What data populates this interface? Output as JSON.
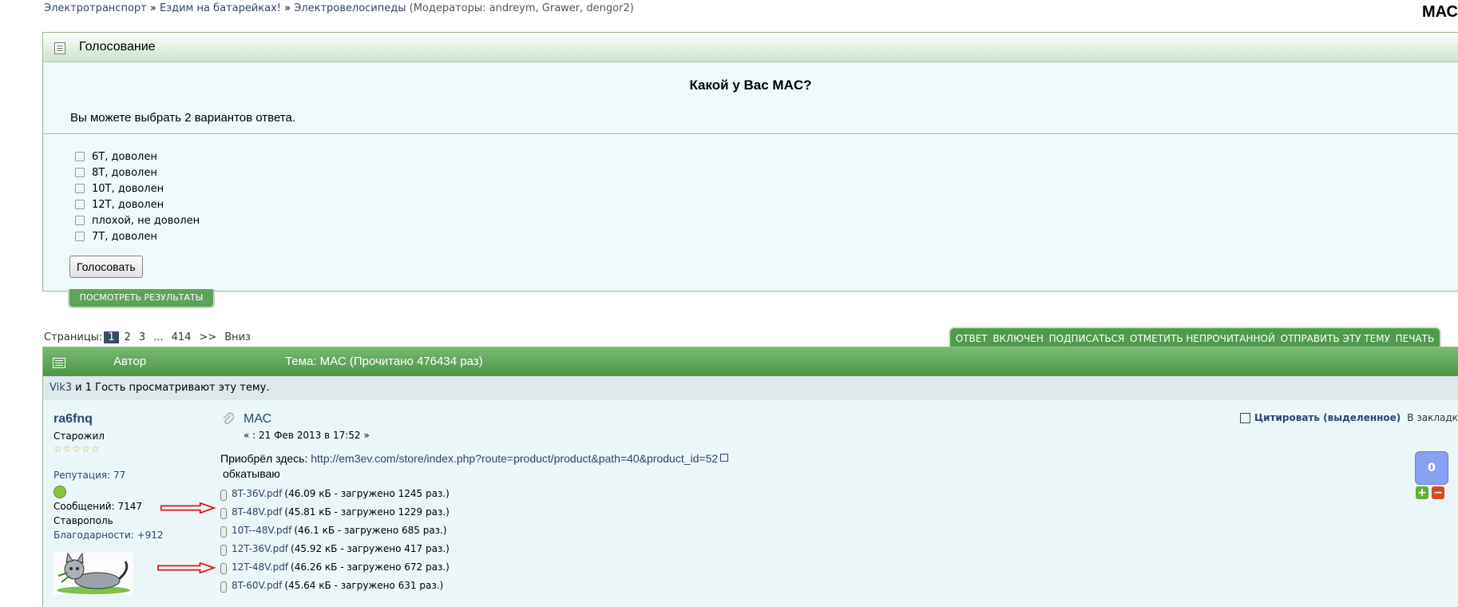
{
  "breadcrumb": {
    "items": [
      "Электротранспорт",
      "Ездим на батарейках!",
      "Электровелосипеды"
    ],
    "sep": " » ",
    "moderators": "(Модераторы: andreym, Grawer, dengor2)"
  },
  "corner_title": "МАС",
  "poll": {
    "header": "Голосование",
    "question": "Какой у Вас MAC?",
    "hint": "Вы можете выбрать 2 вариантов ответа.",
    "options": [
      "6T, доволен",
      "8T, доволен",
      "10T, доволен",
      "12T, доволен",
      "плохой, не доволен",
      "7T, доволен"
    ],
    "vote_label": "Голосовать",
    "results_label": "ПОСМОТРЕТЬ РЕЗУЛЬТАТЫ"
  },
  "pager": {
    "label": "Страницы:",
    "current": "1",
    "pages": [
      "2",
      "3",
      "...",
      "414"
    ],
    "next": ">>",
    "down": "Вниз"
  },
  "actions": [
    "ОТВЕТ",
    "ВКЛЮЧЕН",
    "ПОДПИСАТЬСЯ",
    "ОТМЕТИТЬ НЕПРОЧИТАННОЙ",
    "ОТПРАВИТЬ ЭТУ ТЕМУ",
    "ПЕЧАТЬ"
  ],
  "topic": {
    "author_col": "Автор",
    "title": "Тема: МАС  (Прочитано 476434 раз)"
  },
  "viewers": {
    "user": "Vik3",
    "text": " и 1 Гость просматривают эту тему."
  },
  "poster": {
    "name": "ra6fnq",
    "rank": "Старожил",
    "stars": "☆☆☆☆☆",
    "reputation": "Репутация: 77",
    "posts": "Сообщений: 7147",
    "location": "Ставрополь",
    "thanks": "Благодарности: +912"
  },
  "post": {
    "title": "МАС",
    "date": "« : 21 Фев 2013 в 17:52 »",
    "bought_label": "Приобрёл здесь: ",
    "bought_url": "http://em3ev.com/store/index.php?route=product/product&path=40&product_id=52",
    "body": "обкатываю",
    "attachments": [
      {
        "name": "8T-36V.pdf",
        "meta": "(46.09 кБ - загружено 1245 раз.)"
      },
      {
        "name": "8T-48V.pdf",
        "meta": "(45.81 кБ - загружено 1229 раз.)"
      },
      {
        "name": "10T--48V.pdf",
        "meta": "(46.1 кБ - загружено 685 раз.)"
      },
      {
        "name": "12T-36V.pdf",
        "meta": "(45.92 кБ - загружено 417 раз.)"
      },
      {
        "name": "12T-48V.pdf",
        "meta": "(46.26 кБ - загружено 672 раз.)"
      },
      {
        "name": "8T-60V.pdf",
        "meta": "(45.64 кБ - загружено 631 раз.)"
      }
    ],
    "quote_label": "Цитировать (выделенное)",
    "bookmark_label": "В закладки",
    "karma": "0",
    "karma_plus": "+",
    "karma_minus": "−"
  },
  "colors": {
    "accent_green": "#4f9a4c",
    "link_blue": "#2b4a6b",
    "arrow_red": "#e0141b",
    "karma_blue": "#8aa0f0"
  }
}
